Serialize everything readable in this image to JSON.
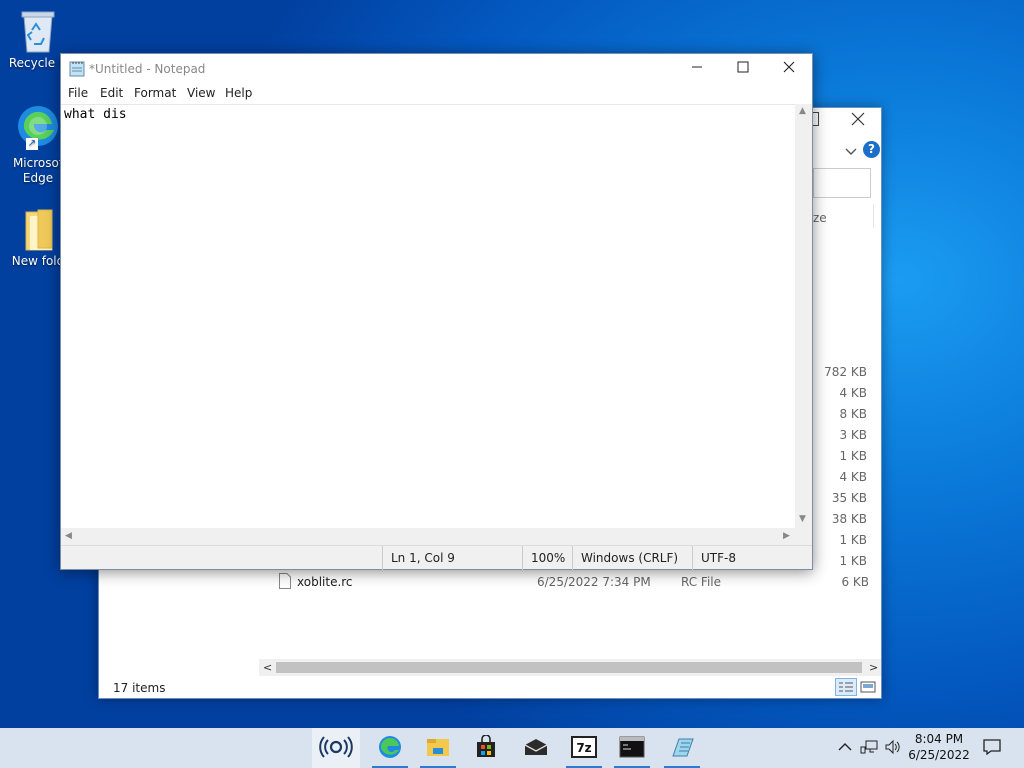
{
  "desktop": {
    "icons": [
      {
        "label": "Recycle B",
        "icon": "recycle-bin-icon"
      },
      {
        "label": "Microsof Edge",
        "icon": "edge-icon"
      },
      {
        "label": "New fold",
        "icon": "folder-icon"
      }
    ]
  },
  "explorer": {
    "partial_header": "ze",
    "help": "?",
    "sizes": [
      "782 KB",
      "4 KB",
      "8 KB",
      "3 KB",
      "1 KB",
      "4 KB",
      "35 KB",
      "38 KB",
      "1 KB",
      "1 KB",
      "6 KB"
    ],
    "file_row": {
      "name": "xoblite.rc",
      "date": "6/25/2022 7:34 PM",
      "type": "RC File",
      "size": "6 KB"
    },
    "status": "17 items"
  },
  "notepad": {
    "title": "*Untitled - Notepad",
    "menu": [
      "File",
      "Edit",
      "Format",
      "View",
      "Help"
    ],
    "content": "what dis",
    "status": {
      "position": "Ln 1, Col 9",
      "zoom": "100%",
      "line_ending": "Windows (CRLF)",
      "encoding": "UTF-8"
    }
  },
  "taskbar": {
    "apps": [
      "cortana-icon",
      "edge-icon",
      "file-explorer-icon",
      "store-icon",
      "mail-icon",
      "7zip-icon",
      "terminal-icon",
      "notepad-icon"
    ],
    "time": "8:04 PM",
    "date": "6/25/2022"
  },
  "colors": {
    "taskbar": "#d9e3ef",
    "accent": "#2b7bd6",
    "desktop": "#0a78d8"
  }
}
